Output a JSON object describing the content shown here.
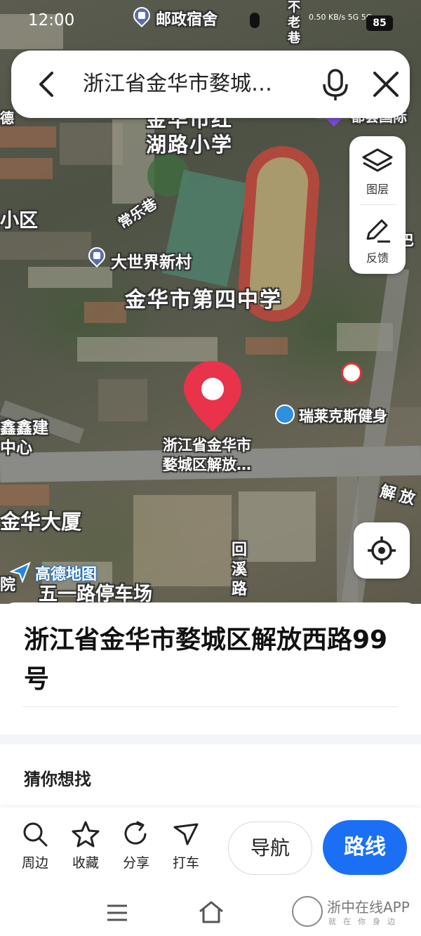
{
  "status_bar": {
    "time": "12:00",
    "battery": "85",
    "network": "0.50 KB/s 5G 5G"
  },
  "search": {
    "query": "浙江省金华市婺城…"
  },
  "map": {
    "labels": {
      "post": "邮政宿舍",
      "lane": "巷",
      "school": "金华市红湖路小学",
      "school_l1": "金华市红",
      "school_l2": "湖路小学",
      "mall": "都荟国际",
      "xiaoqu": "小区",
      "changle": "常乐巷",
      "dashijie": "大世界新村",
      "fourth": "金华市第四中学",
      "xinxin": "鑫鑫建",
      "center": "中心",
      "fitness": "瑞莱克斯健身",
      "pin_l1": "浙江省金华市",
      "pin_l2": "婺城区解放…",
      "jiefang": "解放",
      "jinhua_bldg": "金华大厦",
      "huixi": "回溪路",
      "wuyi": "五一路停车场",
      "yuan": "院",
      "de": "德",
      "ba": "巴"
    },
    "logo_text": "高德地图"
  },
  "side_controls": {
    "layers": "图层",
    "feedback": "反馈"
  },
  "place": {
    "address": "浙江省金华市婺城区解放西路99号",
    "guess_title": "猜你想找"
  },
  "actions": {
    "nearby": "周边",
    "favorite": "收藏",
    "share": "分享",
    "taxi": "打车",
    "navigate": "导航",
    "route": "路线"
  },
  "watermark": {
    "brand": "浙中在线APP",
    "slogan": "就在你身边"
  },
  "colors": {
    "accent": "#1a6ff5",
    "pin": "#e8334a"
  }
}
